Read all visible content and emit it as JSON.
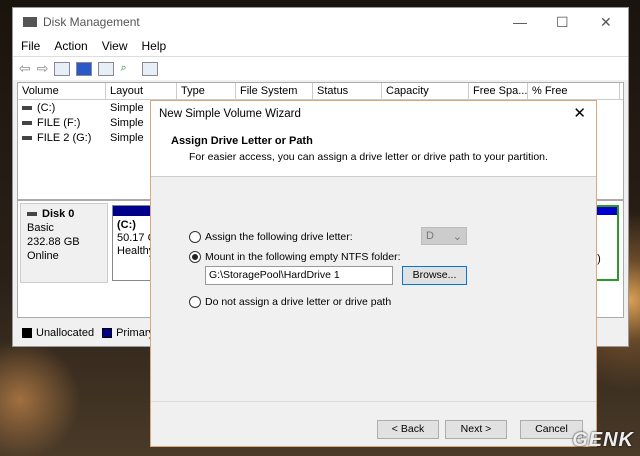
{
  "window": {
    "title": "Disk Management",
    "menu": [
      "File",
      "Action",
      "View",
      "Help"
    ]
  },
  "columns": [
    "Volume",
    "Layout",
    "Type",
    "File System",
    "Status",
    "Capacity",
    "Free Spa...",
    "% Free"
  ],
  "volumes": [
    {
      "name": "(C:)",
      "layout": "Simple"
    },
    {
      "name": "FILE (F:)",
      "layout": "Simple"
    },
    {
      "name": "FILE 2 (G:)",
      "layout": "Simple"
    }
  ],
  "disk": {
    "name": "Disk 0",
    "type": "Basic",
    "size": "232.88 GB",
    "status": "Online",
    "partition": {
      "label": "(C:)",
      "size": "50.17 G",
      "status": "Healthy"
    },
    "right_fragment": "e)"
  },
  "legend": [
    "Unallocated",
    "Primary"
  ],
  "dialog": {
    "title": "New Simple Volume Wizard",
    "heading": "Assign Drive Letter or Path",
    "subheading": "For easier access, you can assign a drive letter or drive path to your partition.",
    "opt1": "Assign the following drive letter:",
    "drive_letter": "D",
    "opt2": "Mount in the following empty NTFS folder:",
    "folder_path": "G:\\StoragePool\\HardDrive 1",
    "browse": "Browse...",
    "opt3": "Do not assign a drive letter or drive path",
    "selected_option": 2,
    "back": "< Back",
    "next": "Next >",
    "cancel": "Cancel"
  },
  "watermark": "GENK"
}
